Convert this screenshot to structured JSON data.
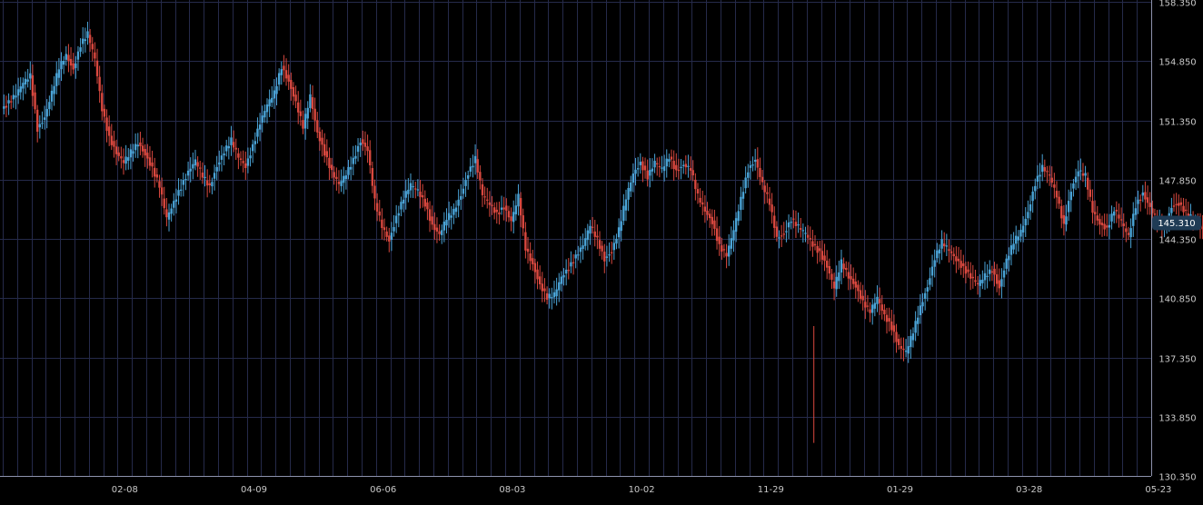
{
  "chart_data": {
    "type": "candlestick",
    "title": "",
    "xlabel": "",
    "ylabel": "",
    "grid": true,
    "legend": "none",
    "colors": {
      "background": "#000000",
      "grid": "#252a4a",
      "axis": "#8e93ad",
      "up": "#4aa3d6",
      "down": "#d9483f",
      "tick_text": "#c8c8c8",
      "price_tag_bg": "#1f3b55",
      "price_tag_text": "#ffffff"
    },
    "ylim": [
      130.35,
      158.35
    ],
    "y_ticks": [
      "130.350",
      "133.850",
      "137.350",
      "140.850",
      "144.350",
      "147.850",
      "151.350",
      "154.850",
      "158.350"
    ],
    "x_ticks": [
      {
        "label": "02-08",
        "at": 17
      },
      {
        "label": "04-09",
        "at": 35
      },
      {
        "label": "06-06",
        "at": 53
      },
      {
        "label": "08-03",
        "at": 71
      },
      {
        "label": "10-02",
        "at": 89
      },
      {
        "label": "11-29",
        "at": 107
      },
      {
        "label": "01-29",
        "at": 125
      },
      {
        "label": "03-28",
        "at": 143
      },
      {
        "label": "05-23",
        "at": 161
      }
    ],
    "last_price": "145.310",
    "x_range": [
      2,
      168
    ],
    "close": [
      151.9,
      152.4,
      152.9,
      153.6,
      154.0,
      150.8,
      151.5,
      153.0,
      154.5,
      155.2,
      154.3,
      155.8,
      156.5,
      155.0,
      152.0,
      150.3,
      149.4,
      148.9,
      149.5,
      150.0,
      149.3,
      148.5,
      147.5,
      145.6,
      146.5,
      147.4,
      148.3,
      149.0,
      148.1,
      147.4,
      148.6,
      149.5,
      150.2,
      149.2,
      148.6,
      149.8,
      151.2,
      152.3,
      153.0,
      154.5,
      153.6,
      152.4,
      151.0,
      152.8,
      150.6,
      149.4,
      148.3,
      147.6,
      148.2,
      149.0,
      150.1,
      149.6,
      146.6,
      145.1,
      144.2,
      145.6,
      146.8,
      147.6,
      147.2,
      146.4,
      145.1,
      144.6,
      145.6,
      146.0,
      146.9,
      148.2,
      149.1,
      147.0,
      146.4,
      145.8,
      146.2,
      145.4,
      146.9,
      143.8,
      142.8,
      141.6,
      140.9,
      141.1,
      142.1,
      142.6,
      143.3,
      144.0,
      145.2,
      144.3,
      143.1,
      143.6,
      144.9,
      146.8,
      148.2,
      148.8,
      148.0,
      148.9,
      148.5,
      149.2,
      148.3,
      148.7,
      148.5,
      146.9,
      146.0,
      145.3,
      143.9,
      143.4,
      144.9,
      146.7,
      148.4,
      149.0,
      147.6,
      146.5,
      144.4,
      144.6,
      145.5,
      145.1,
      144.7,
      144.0,
      143.5,
      142.7,
      141.5,
      143.0,
      142.1,
      141.5,
      140.6,
      140.1,
      140.9,
      139.8,
      139.1,
      138.0,
      137.7,
      138.9,
      140.3,
      141.5,
      143.2,
      144.2,
      143.7,
      143.1,
      142.6,
      142.1,
      141.7,
      142.2,
      142.5,
      141.4,
      143.1,
      144.2,
      144.8,
      145.9,
      147.6,
      148.6,
      148.1,
      146.9,
      145.1,
      147.2,
      148.4,
      148.1,
      146.0,
      145.2,
      144.9,
      146.1,
      145.4,
      144.5,
      146.3,
      147.0,
      146.2,
      145.4,
      145.0,
      146.2,
      146.4,
      145.9,
      145.6,
      145.1,
      144.3,
      144.8,
      145.31
    ]
  }
}
